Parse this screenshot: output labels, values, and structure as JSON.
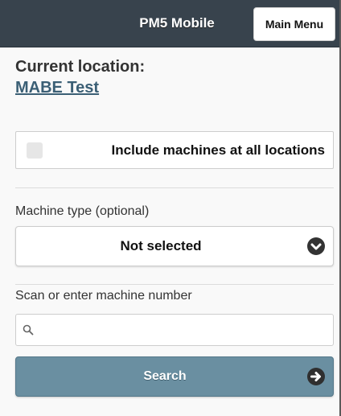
{
  "header": {
    "title": "PM5 Mobile",
    "main_menu_label": "Main Menu"
  },
  "location": {
    "heading": "Current location:",
    "name": "MABE Test"
  },
  "include_all": {
    "label": "Include machines at all locations",
    "checked": false
  },
  "machine_type": {
    "label": "Machine type (optional)",
    "selected": "Not selected",
    "icon": "chevron-down-circle-icon"
  },
  "machine_number": {
    "label": "Scan or enter machine number",
    "value": "",
    "icon": "search-icon"
  },
  "search_button": {
    "label": "Search",
    "icon": "arrow-right-circle-icon"
  },
  "colors": {
    "header_bg": "#38434d",
    "link": "#3b5f75",
    "search_button_bg": "#6a8fa1"
  }
}
